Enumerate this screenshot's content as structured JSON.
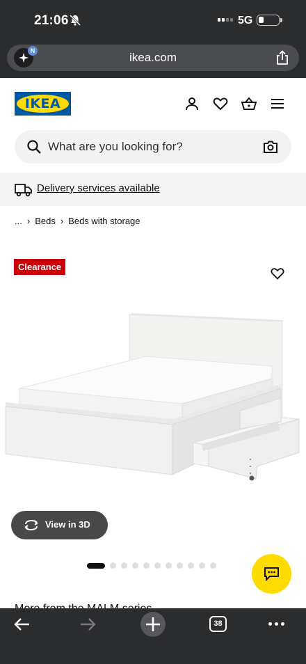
{
  "status_bar": {
    "time": "21:06",
    "network": "5G",
    "icons": [
      "bell-muted-icon",
      "signal-icon",
      "battery-icon"
    ]
  },
  "browser": {
    "url": "ikea.com",
    "extension_badge": "N",
    "tab_count": "38",
    "icons": [
      "extension-icon",
      "share-icon",
      "back-arrow-icon",
      "forward-arrow-icon",
      "plus-icon",
      "tabs-icon",
      "more-icon"
    ]
  },
  "header": {
    "logo_text": "IKEA",
    "icons": [
      "profile-icon",
      "heart-icon",
      "basket-icon",
      "menu-icon"
    ]
  },
  "search": {
    "placeholder": "What are you looking for?",
    "icons": [
      "search-icon",
      "camera-icon"
    ]
  },
  "delivery": {
    "label": "Delivery services available",
    "icon": "truck-icon"
  },
  "breadcrumb": {
    "items": [
      "...",
      "Beds",
      "Beds with storage"
    ]
  },
  "product": {
    "badge": "Clearance",
    "view_3d_label": "View in 3D",
    "image_count": 11,
    "active_image": 1,
    "colors": {
      "badge": "#cc0008",
      "fab": "#ffdb00",
      "brand_blue": "#0058a3",
      "brand_yellow": "#ffdb00"
    }
  },
  "more_section": {
    "title": "More from the MALM series"
  }
}
